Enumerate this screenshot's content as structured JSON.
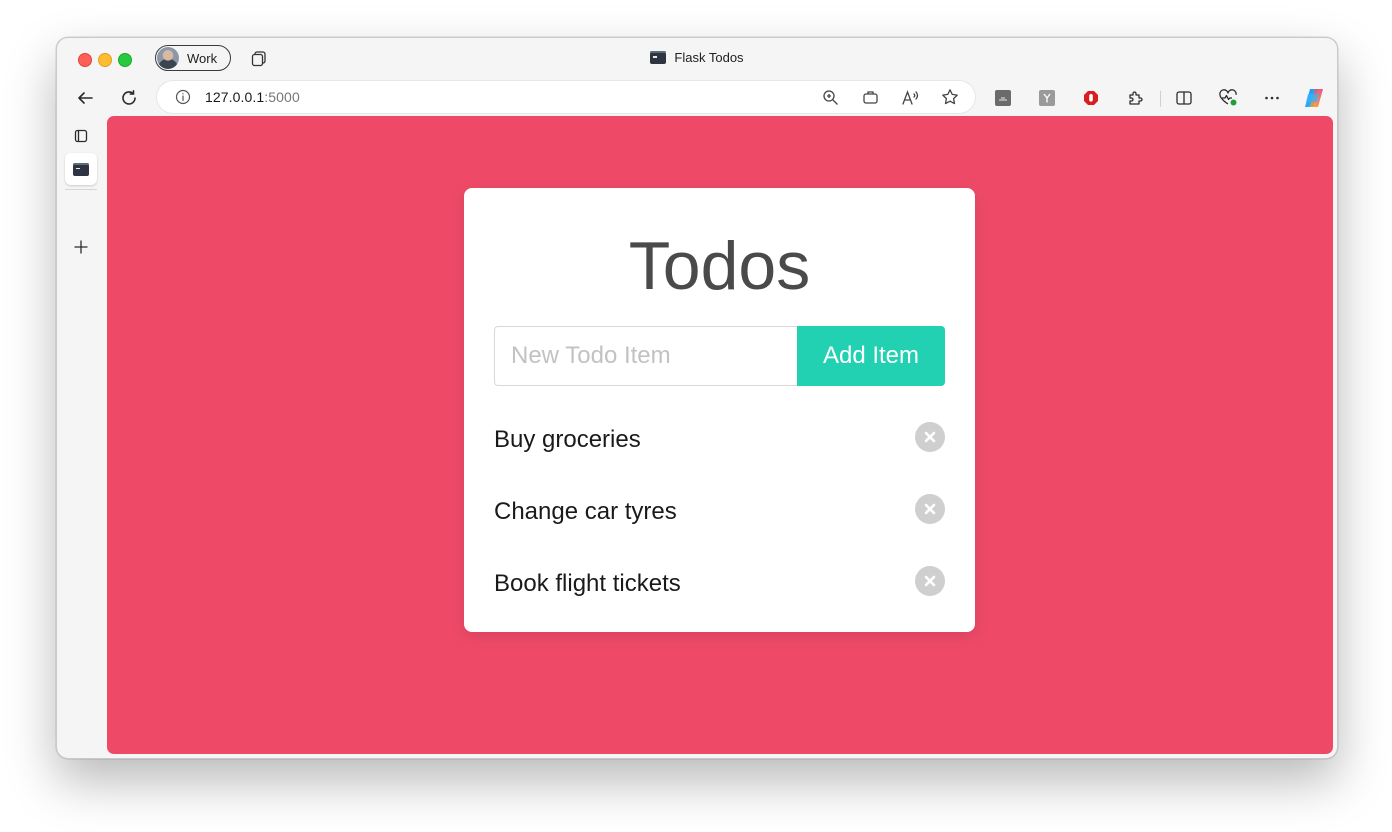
{
  "browser": {
    "profile_label": "Work",
    "tab_title": "Flask Todos",
    "url_host": "127.0.0.1",
    "url_port": ":5000",
    "icons": [
      "tabs-icon",
      "back-icon",
      "reload-icon",
      "info-icon",
      "zoom-icon",
      "app-icon",
      "read-aloud-icon",
      "favorite-star-icon",
      "extension-icon",
      "split-screen-icon",
      "browser-essentials-icon",
      "more-icon",
      "copilot-icon"
    ]
  },
  "page": {
    "background_color": "#ee4a68",
    "accent_color": "#22d1b2",
    "title": "Todos",
    "input_placeholder": "New Todo Item",
    "input_value": "",
    "add_button_label": "Add Item",
    "todos": [
      {
        "text": "Buy groceries"
      },
      {
        "text": "Change car tyres"
      },
      {
        "text": "Book flight tickets"
      }
    ]
  }
}
